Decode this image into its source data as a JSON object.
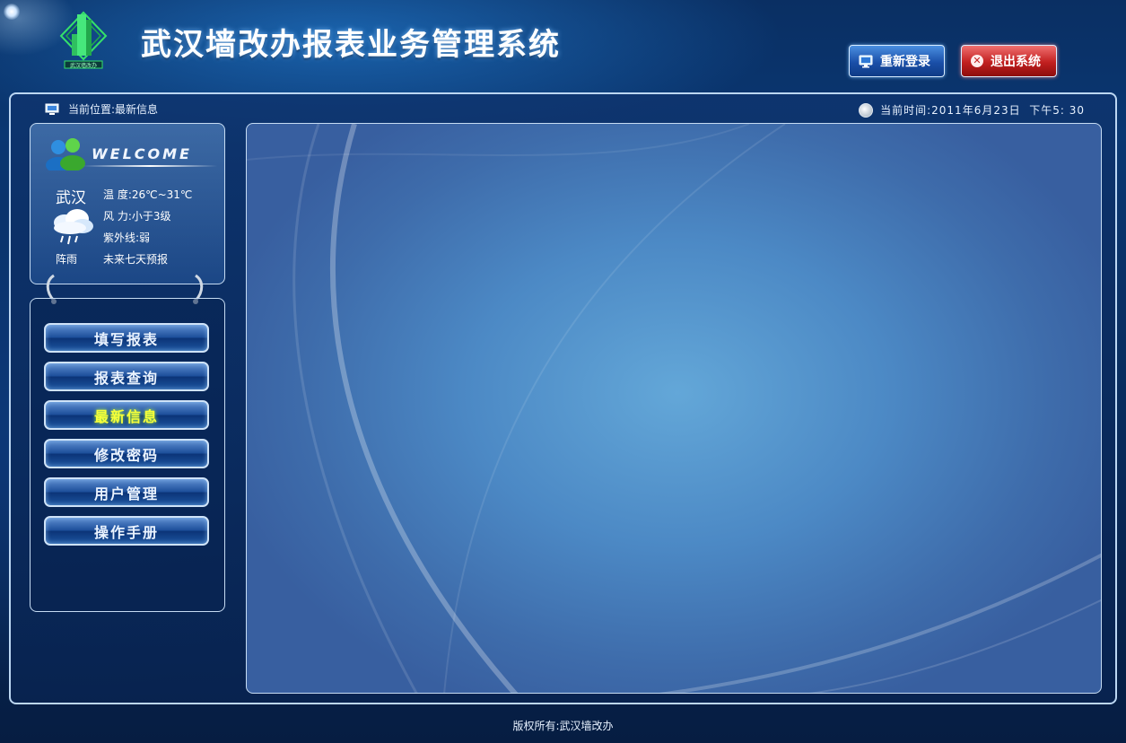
{
  "header": {
    "title": "武汉墙改办报表业务管理系统",
    "relogin_label": "重新登录",
    "exit_label": "退出系统",
    "logo_text": "武汉墙改办"
  },
  "location": {
    "label": "当前位置:",
    "value": "最新信息"
  },
  "time": {
    "label": "当前时间:",
    "value": "2011年6月23日  下午5: 30"
  },
  "weather": {
    "welcome": "WELCOME",
    "city": "武汉",
    "condition": "阵雨",
    "temperature": "温  度:26℃~31℃",
    "wind": "风  力:小于3级",
    "uv": "紫外线:弱",
    "forecast": "未来七天预报"
  },
  "nav": {
    "items": [
      {
        "label": "填写报表"
      },
      {
        "label": "报表查询"
      },
      {
        "label": "最新信息"
      },
      {
        "label": "修改密码"
      },
      {
        "label": "用户管理"
      },
      {
        "label": "操作手册"
      }
    ],
    "active_index": 2
  },
  "footer": {
    "copyright": "版权所有:武汉墙改办"
  },
  "colors": {
    "active_nav_text": "#f7ff3a",
    "exit_button": "#c11f1f",
    "relogin_button": "#1a4fa8"
  },
  "icons": {
    "relogin": "monitor-icon",
    "exit": "close-circle-icon",
    "location": "monitor-icon",
    "time": "clock-icon",
    "weather": "rain-cloud-icon",
    "welcome": "users-icon"
  }
}
